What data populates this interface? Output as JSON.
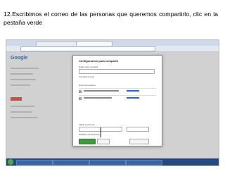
{
  "caption": "12.Escribimos el correo de las personas que queremos compartirlo, clic en la pestaña verde"
}
